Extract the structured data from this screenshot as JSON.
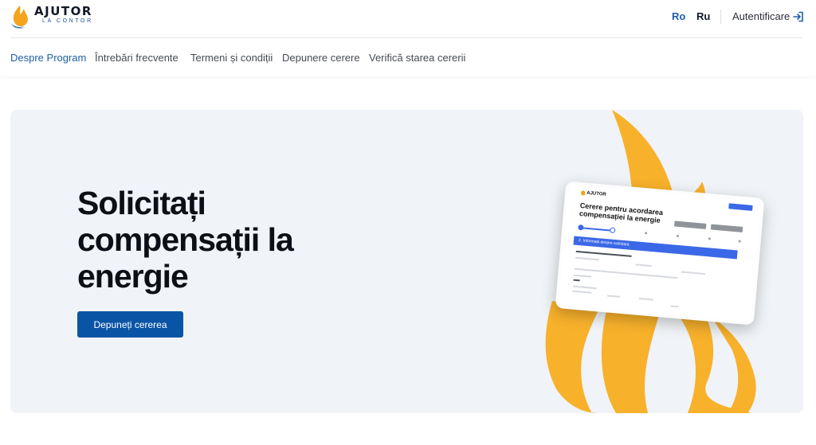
{
  "header": {
    "logo_main": "AJUTOR",
    "logo_sub": "LA CONTOR",
    "lang_ro": "Ro",
    "lang_ru": "Ru",
    "login_label": "Autentificare"
  },
  "nav": {
    "items": [
      {
        "label": "Despre Program",
        "active": true
      },
      {
        "label": "Întrebări frecvente",
        "active": false
      },
      {
        "label": "Termeni și condiții",
        "active": false
      },
      {
        "label": "Depunere cerere",
        "active": false
      },
      {
        "label": "Verifică starea cererii",
        "active": false
      }
    ]
  },
  "hero": {
    "title_lines": [
      "Solicitați",
      "compensații la",
      "energie"
    ],
    "cta_label": "Depuneți cererea",
    "tablet": {
      "logo": "AJUTOR",
      "title_lines": [
        "Cerere pentru acordarea",
        "compensației la energie"
      ],
      "section_label": "2. Informații despre solicitant"
    }
  },
  "colors": {
    "accent": "#1f5fa8",
    "cta": "#0a54a6",
    "hero_bg": "#f0f3f7",
    "flame": "#f8b12b"
  },
  "icons": [
    "flame-logo-icon",
    "login-arrow-icon"
  ]
}
